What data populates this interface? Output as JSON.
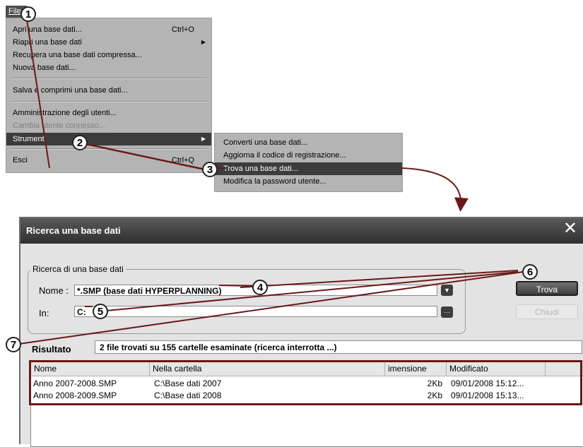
{
  "menubar": {
    "file": "File"
  },
  "menu": {
    "items": [
      {
        "label": "Apri una base dati...",
        "shortcut": "Ctrl+O"
      },
      {
        "label": "Riapri una base dati",
        "submenu": true
      },
      {
        "label": "Recupera una base dati compressa..."
      },
      {
        "label": "Nuova base dati..."
      },
      {
        "label": "Salva e comprimi una base dati..."
      },
      {
        "label": "Amministrazione degli utenti..."
      },
      {
        "label": "Cambia utente connesso...",
        "disabled": true
      },
      {
        "label": "Strumenti",
        "submenu": true,
        "selected": true
      },
      {
        "label": "Esci",
        "shortcut": "Ctrl+Q"
      }
    ]
  },
  "submenu": {
    "items": [
      {
        "label": "Converti una base dati..."
      },
      {
        "label": "Aggiorna il codice di registrazione..."
      },
      {
        "label": "Trova una base dati...",
        "selected": true
      },
      {
        "label": "Modifica la password utente..."
      }
    ]
  },
  "dialog": {
    "title": "Ricerca una base dati",
    "group_title": "Ricerca di una base dati",
    "nome_label": "Nome :",
    "nome_value": "*.SMP  (base dati HYPERPLANNING)",
    "in_label": "In:",
    "in_value": "C:",
    "trova_button": "Trova",
    "chiudi_button": "Chiudi",
    "risultato_label": "Risultato",
    "risultato_text": "2 file trovati su  155 cartelle esaminate (ricerca interrotta ...)",
    "columns": [
      "Nome",
      "Nella cartella",
      "imensione",
      "Modificato"
    ],
    "rows": [
      {
        "nome": "Anno 2007-2008.SMP",
        "cartella": "C:\\Base dati 2007",
        "dimensione": "2Kb",
        "modificato": "09/01/2008 15:12..."
      },
      {
        "nome": "Anno 2008-2009.SMP",
        "cartella": "C:\\Base dati 2008",
        "dimensione": "2Kb",
        "modificato": "09/01/2008 15:13..."
      }
    ]
  },
  "callouts": [
    "1",
    "2",
    "3",
    "4",
    "5",
    "6",
    "7"
  ],
  "colors": {
    "annotation": "#6b1818",
    "menu_bg": "#b4b4b4",
    "menu_selected": "#3c3c3c",
    "titlebar": "#3a3a3a"
  }
}
